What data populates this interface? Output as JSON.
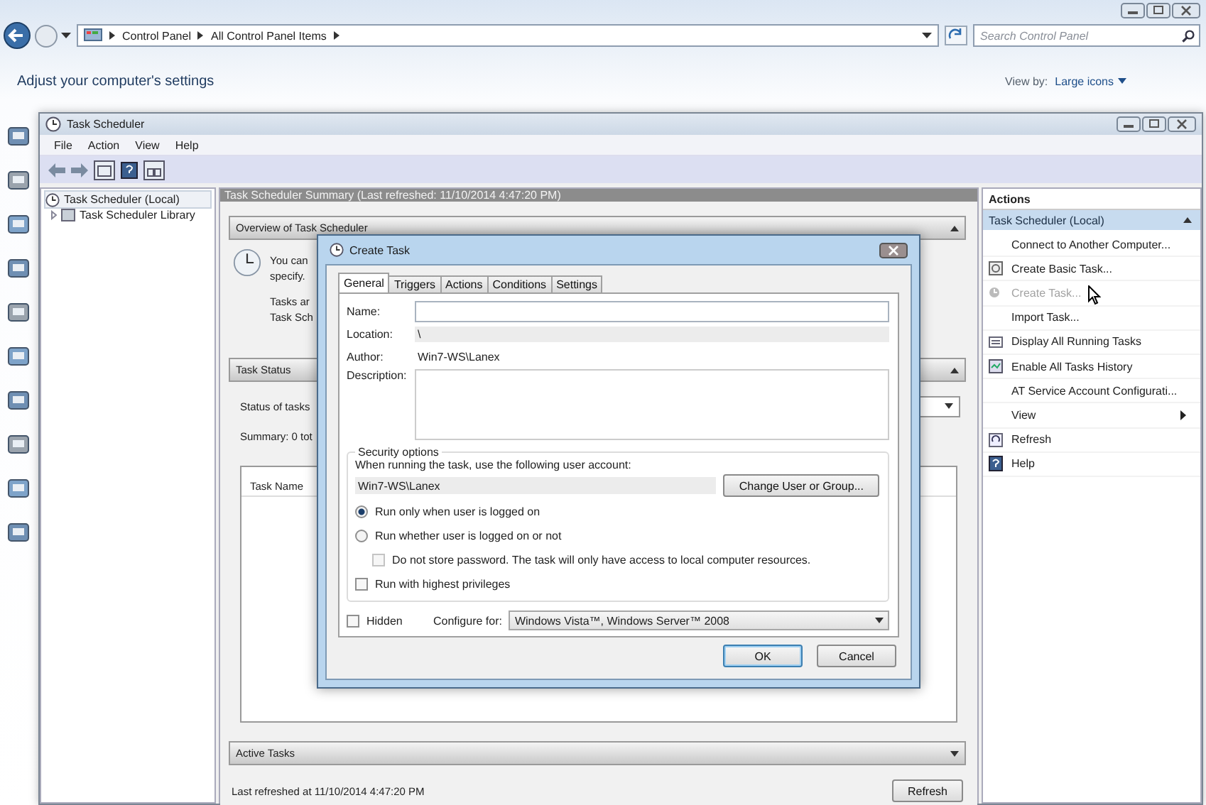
{
  "explorer": {
    "breadcrumb": [
      "Control Panel",
      "All Control Panel Items"
    ],
    "search": {
      "placeholder": "Search Control Panel"
    },
    "heading": "Adjust your computer's settings",
    "view_by_label": "View by:",
    "view_by_value": "Large icons"
  },
  "task_scheduler": {
    "title": "Task Scheduler",
    "menu": [
      "File",
      "Action",
      "View",
      "Help"
    ],
    "tree": [
      {
        "label": "Task Scheduler (Local)",
        "selected": true,
        "children": [
          {
            "label": "Task Scheduler Library",
            "selected": false
          }
        ]
      }
    ],
    "summary_title": "Task Scheduler Summary (Last refreshed: 11/10/2014 4:47:20 PM)",
    "overview": {
      "header": "Overview of Task Scheduler",
      "expanded": true,
      "lines_top": [
        "You can",
        "specify."
      ],
      "lines_bottom": [
        "Tasks ar",
        "Task Sch"
      ]
    },
    "task_status": {
      "header": "Task Status",
      "expanded": true,
      "status_label": "Status of tasks",
      "summary": "Summary: 0 tot",
      "columns": [
        "Task Name"
      ]
    },
    "active_tasks": {
      "header": "Active Tasks",
      "expanded": false
    },
    "last_refreshed": "Last refreshed at 11/10/2014 4:47:20 PM",
    "refresh_button": "Refresh",
    "actions": {
      "title": "Actions",
      "group": "Task Scheduler (Local)",
      "group_expanded": true,
      "items": [
        {
          "label": "Connect to Another Computer...",
          "disabled": false,
          "submenu": false
        },
        {
          "label": "Create Basic Task...",
          "disabled": false,
          "submenu": false
        },
        {
          "label": "Create Task...",
          "disabled": true,
          "submenu": false
        },
        {
          "label": "Import Task...",
          "disabled": false,
          "submenu": false
        },
        {
          "label": "Display All Running Tasks",
          "disabled": false,
          "submenu": false
        },
        {
          "label": "Enable All Tasks History",
          "disabled": false,
          "submenu": false
        },
        {
          "label": "AT Service Account Configurati...",
          "disabled": false,
          "submenu": false
        },
        {
          "label": "View",
          "disabled": false,
          "submenu": true
        },
        {
          "label": "Refresh",
          "disabled": false,
          "submenu": false
        },
        {
          "label": "Help",
          "disabled": false,
          "submenu": false
        }
      ]
    }
  },
  "dialog": {
    "title": "Create Task",
    "tabs": [
      {
        "label": "General",
        "selected": true
      },
      {
        "label": "Triggers",
        "selected": false
      },
      {
        "label": "Actions",
        "selected": false
      },
      {
        "label": "Conditions",
        "selected": false
      },
      {
        "label": "Settings",
        "selected": false
      }
    ],
    "name_label": "Name:",
    "location_label": "Location:",
    "location": "\\",
    "author_label": "Author:",
    "author": "Win7-WS\\Lanex",
    "description_label": "Description:",
    "security": {
      "legend": "Security options",
      "account_prompt": "When running the task, use the following user account:",
      "account": "Win7-WS\\Lanex",
      "change_button": "Change User or Group...",
      "options": [
        {
          "kind": "radio",
          "label": "Run only when user is logged on",
          "checked": true,
          "disabled": false
        },
        {
          "kind": "radio",
          "label": "Run whether user is logged on or not",
          "checked": false,
          "disabled": false,
          "children": [
            {
              "kind": "checkbox",
              "label": "Do not store password.  The task will only have access to local computer resources.",
              "checked": false,
              "disabled": true
            }
          ]
        },
        {
          "kind": "checkbox",
          "label": "Run with highest privileges",
          "checked": false,
          "disabled": false
        }
      ]
    },
    "hidden": {
      "label": "Hidden",
      "checked": false
    },
    "configure_label": "Configure for:",
    "configure_value": "Windows Vista™, Windows Server™ 2008",
    "buttons": [
      {
        "label": "OK",
        "default": true
      },
      {
        "label": "Cancel",
        "default": false
      }
    ]
  }
}
